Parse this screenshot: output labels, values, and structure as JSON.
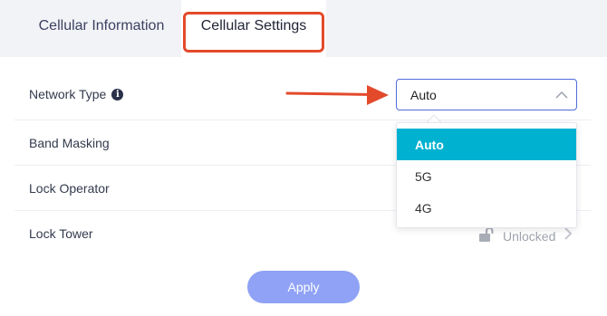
{
  "tabs": [
    {
      "label": "Cellular Information"
    },
    {
      "label": "Cellular Settings"
    }
  ],
  "rows": {
    "network_type": "Network Type",
    "band_masking": "Band Masking",
    "lock_operator": "Lock Operator",
    "lock_tower": "Lock Tower"
  },
  "network_select": {
    "value": "Auto",
    "options": [
      "Auto",
      "5G",
      "4G"
    ]
  },
  "lock_tower_status": "Unlocked",
  "apply_label": "Apply",
  "colors": {
    "accent": "#4f6bd9",
    "highlight_option": "#00b1d0",
    "annotation": "#e34a2b",
    "apply_button": "#8fa2f5"
  },
  "icons": [
    "info-icon",
    "chevron-up-icon",
    "lock-icon",
    "chevron-right-icon",
    "arrow-annotation-icon"
  ]
}
